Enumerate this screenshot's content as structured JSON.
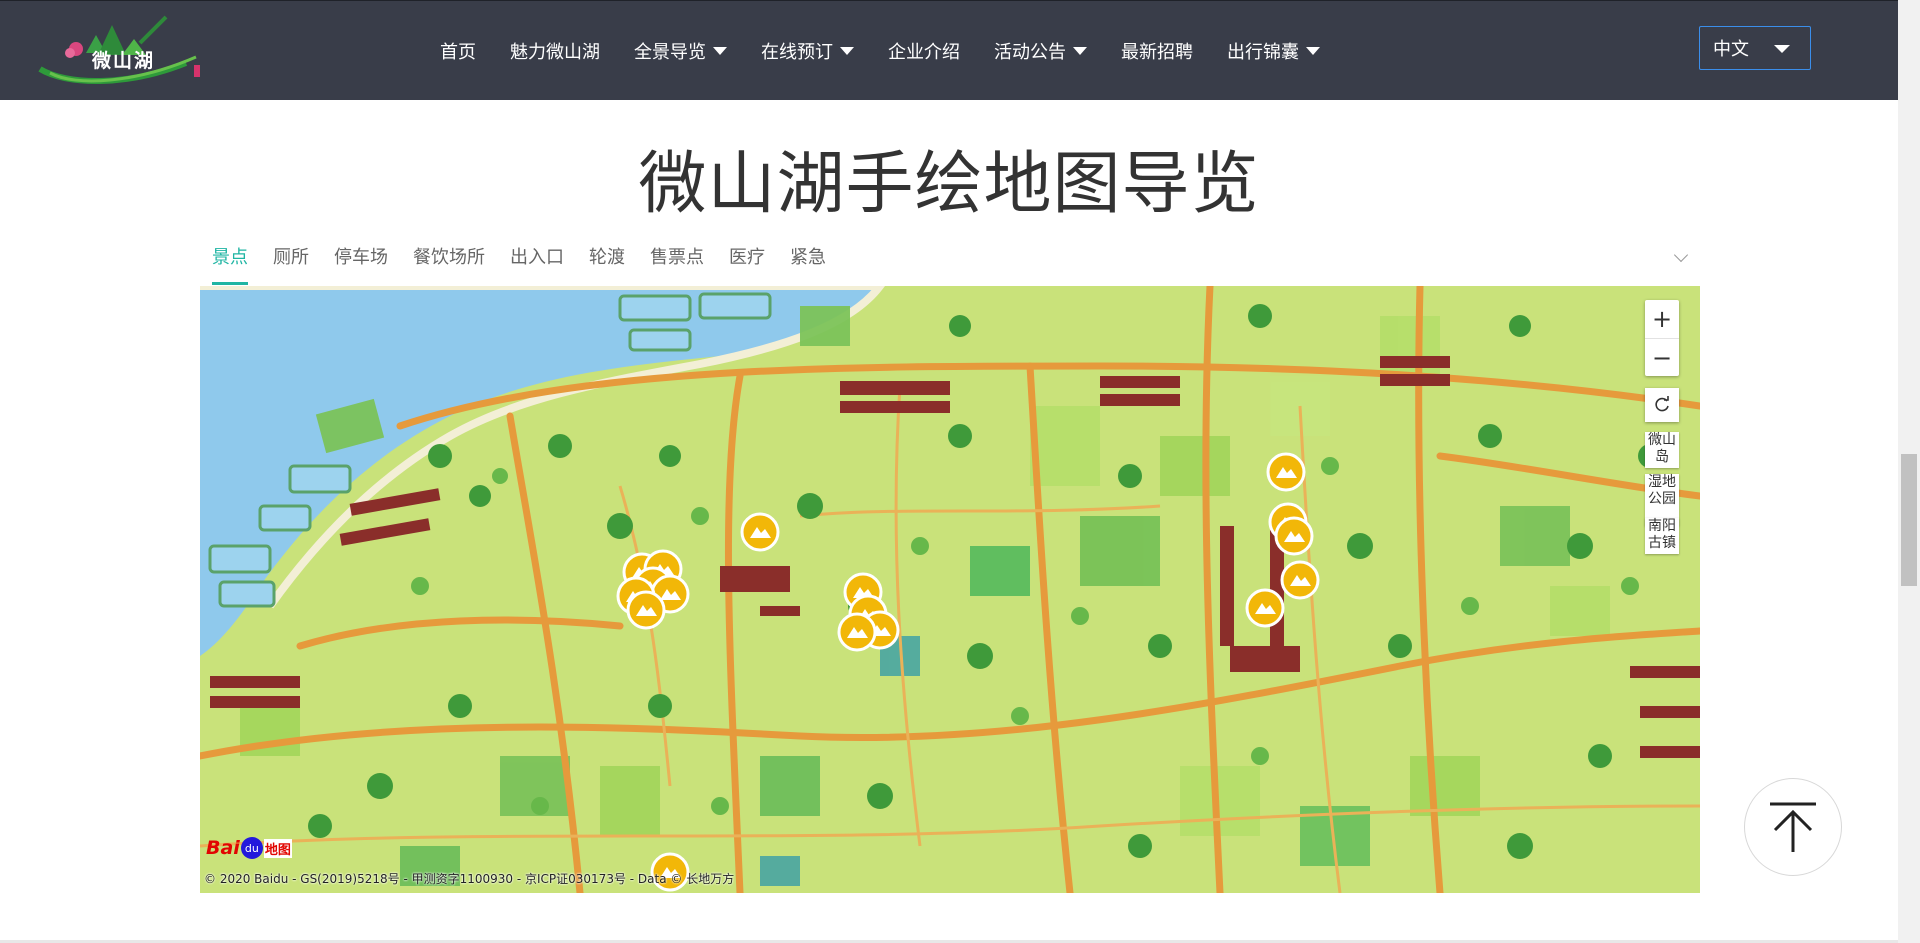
{
  "header": {
    "logo_text": "微山湖",
    "nav": [
      {
        "label": "首页",
        "has_dropdown": false
      },
      {
        "label": "魅力微山湖",
        "has_dropdown": false
      },
      {
        "label": "全景导览",
        "has_dropdown": true
      },
      {
        "label": "在线预订",
        "has_dropdown": true
      },
      {
        "label": "企业介绍",
        "has_dropdown": false
      },
      {
        "label": "活动公告",
        "has_dropdown": true
      },
      {
        "label": "最新招聘",
        "has_dropdown": false
      },
      {
        "label": "出行锦囊",
        "has_dropdown": true
      }
    ],
    "language": "中文"
  },
  "page_title": "微山湖手绘地图导览",
  "tabs": {
    "items": [
      "景点",
      "厕所",
      "停车场",
      "餐饮场所",
      "出入口",
      "轮渡",
      "售票点",
      "医疗",
      "紧急"
    ],
    "active_index": 0
  },
  "map": {
    "zoom_in": "+",
    "zoom_out": "−",
    "places": [
      "微山岛",
      "湿地公园",
      "南阳古镇"
    ],
    "baidu_logo_bai": "Bai",
    "baidu_logo_du": "du",
    "baidu_logo_ditu": "地图",
    "copyright": "© 2020 Baidu - GS(2019)5218号 - 甲测资字1100930 - 京ICP证030173号 - Data © 长地万方",
    "marker_icon": "scenic-spot-mountain-icon",
    "colors": {
      "water": "#8fc9ec",
      "grass": "#c9e27a",
      "field": "#a8d65a",
      "road": "#e69a3c",
      "marker": "#f2b708"
    }
  },
  "colors": {
    "header_bg": "#393d49",
    "accent": "#1fb5a3",
    "lang_border": "#3b8eea"
  }
}
